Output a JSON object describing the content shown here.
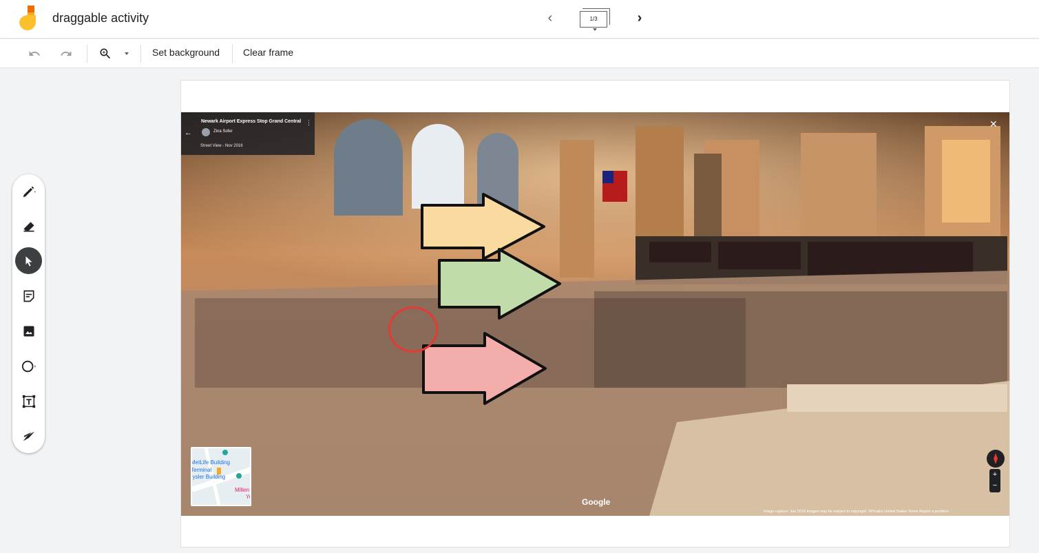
{
  "header": {
    "app_title": "draggable activity",
    "frame_counter": "1/3",
    "prev_icon": "chevron-left-icon",
    "next_icon": "chevron-right-icon"
  },
  "toolbar": {
    "undo_icon": "undo-icon",
    "redo_icon": "redo-icon",
    "zoom_icon": "zoom-in-icon",
    "set_background_label": "Set background",
    "clear_frame_label": "Clear frame"
  },
  "sidebar": {
    "tools": [
      "pen-icon",
      "eraser-icon",
      "select-icon",
      "sticky-note-icon",
      "image-icon",
      "circle-shape-icon",
      "text-box-icon",
      "laser-icon"
    ],
    "active_tool": "select-icon"
  },
  "streetview": {
    "title": "Newark Airport Express Stop Grand Central",
    "author": "Zina Sofer",
    "date": "Street View - Nov 2016",
    "google": "Google",
    "footer": "Image capture: Jun 2016   Images may be subject to copyright.   ©Picalco   United States   Terms   Report a problem",
    "minimap_labels": [
      "MetLife Building",
      "Terminal",
      "rysler Building",
      "Millen",
      "Yo"
    ]
  },
  "colors": {
    "arrow_yellow": "#f9dba0",
    "arrow_green": "#c2dbab",
    "arrow_pink": "#f3aeab",
    "circle_red": "#e53935",
    "active_tool_bg": "#3c4043"
  }
}
